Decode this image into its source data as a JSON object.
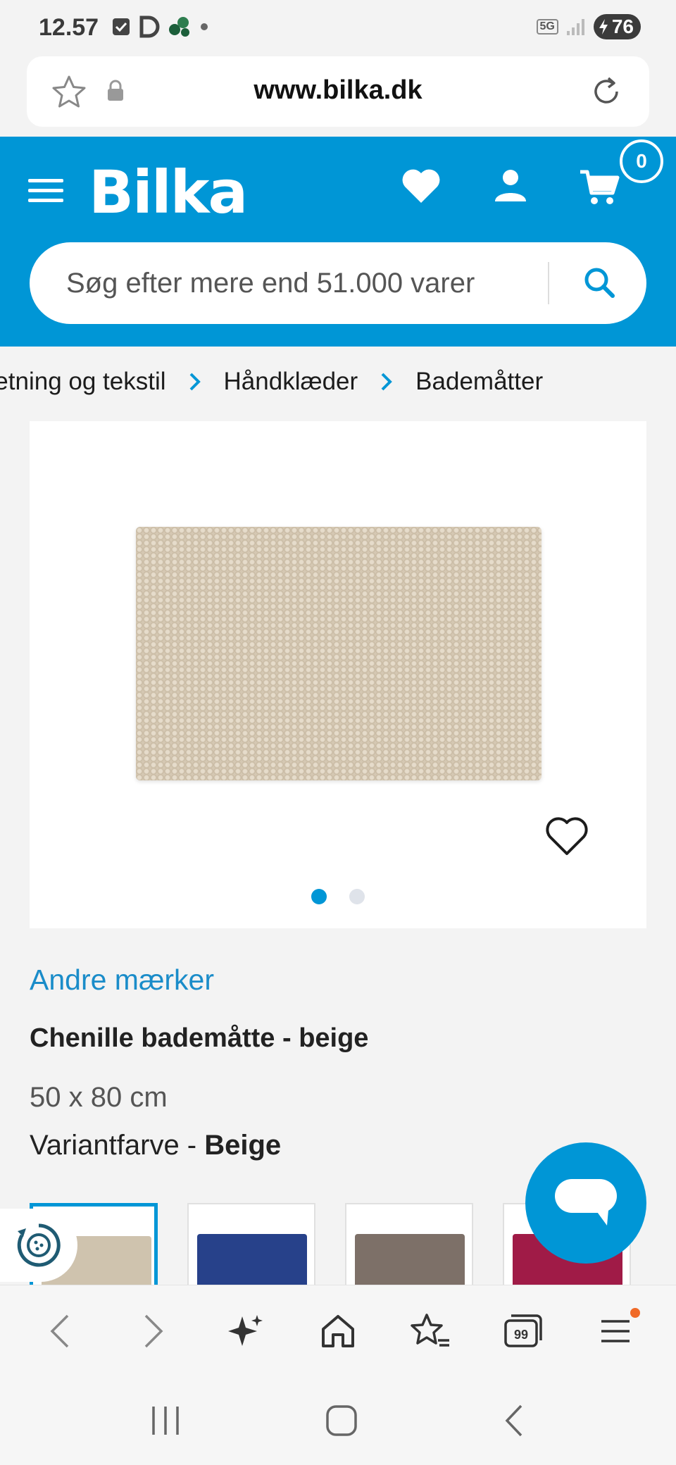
{
  "status_bar": {
    "time": "12.57",
    "network": "5G",
    "battery": "76"
  },
  "browser": {
    "url": "www.bilka.dk"
  },
  "header": {
    "logo": "Bilka",
    "cart_count": "0",
    "search_placeholder": "Søg efter mere end 51.000 varer",
    "brand_color": "#0096d6"
  },
  "breadcrumb": {
    "items": [
      "Indretning og tekstil",
      "Håndklæder",
      "Bademåtter"
    ]
  },
  "product": {
    "image_dots_total": 2,
    "image_dots_active": 1,
    "brand": "Andre mærker",
    "title": "Chenille bademåtte - beige",
    "size": "50 x 80 cm",
    "variant_label": "Variantfarve - ",
    "variant_value": "Beige",
    "swatches": [
      {
        "name": "Beige",
        "color": "#cfc3ae",
        "selected": true
      },
      {
        "name": "Blå",
        "color": "#27418a",
        "selected": false
      },
      {
        "name": "Brun",
        "color": "#7d7068",
        "selected": false
      },
      {
        "name": "Rød",
        "color": "#a01b47",
        "selected": false
      }
    ]
  },
  "browser_nav": {
    "icons": [
      "back-icon",
      "forward-icon",
      "sparkle-icon",
      "home-icon",
      "bookmarks-icon",
      "tabs-icon",
      "menu-icon"
    ],
    "tabs_count": "99"
  }
}
